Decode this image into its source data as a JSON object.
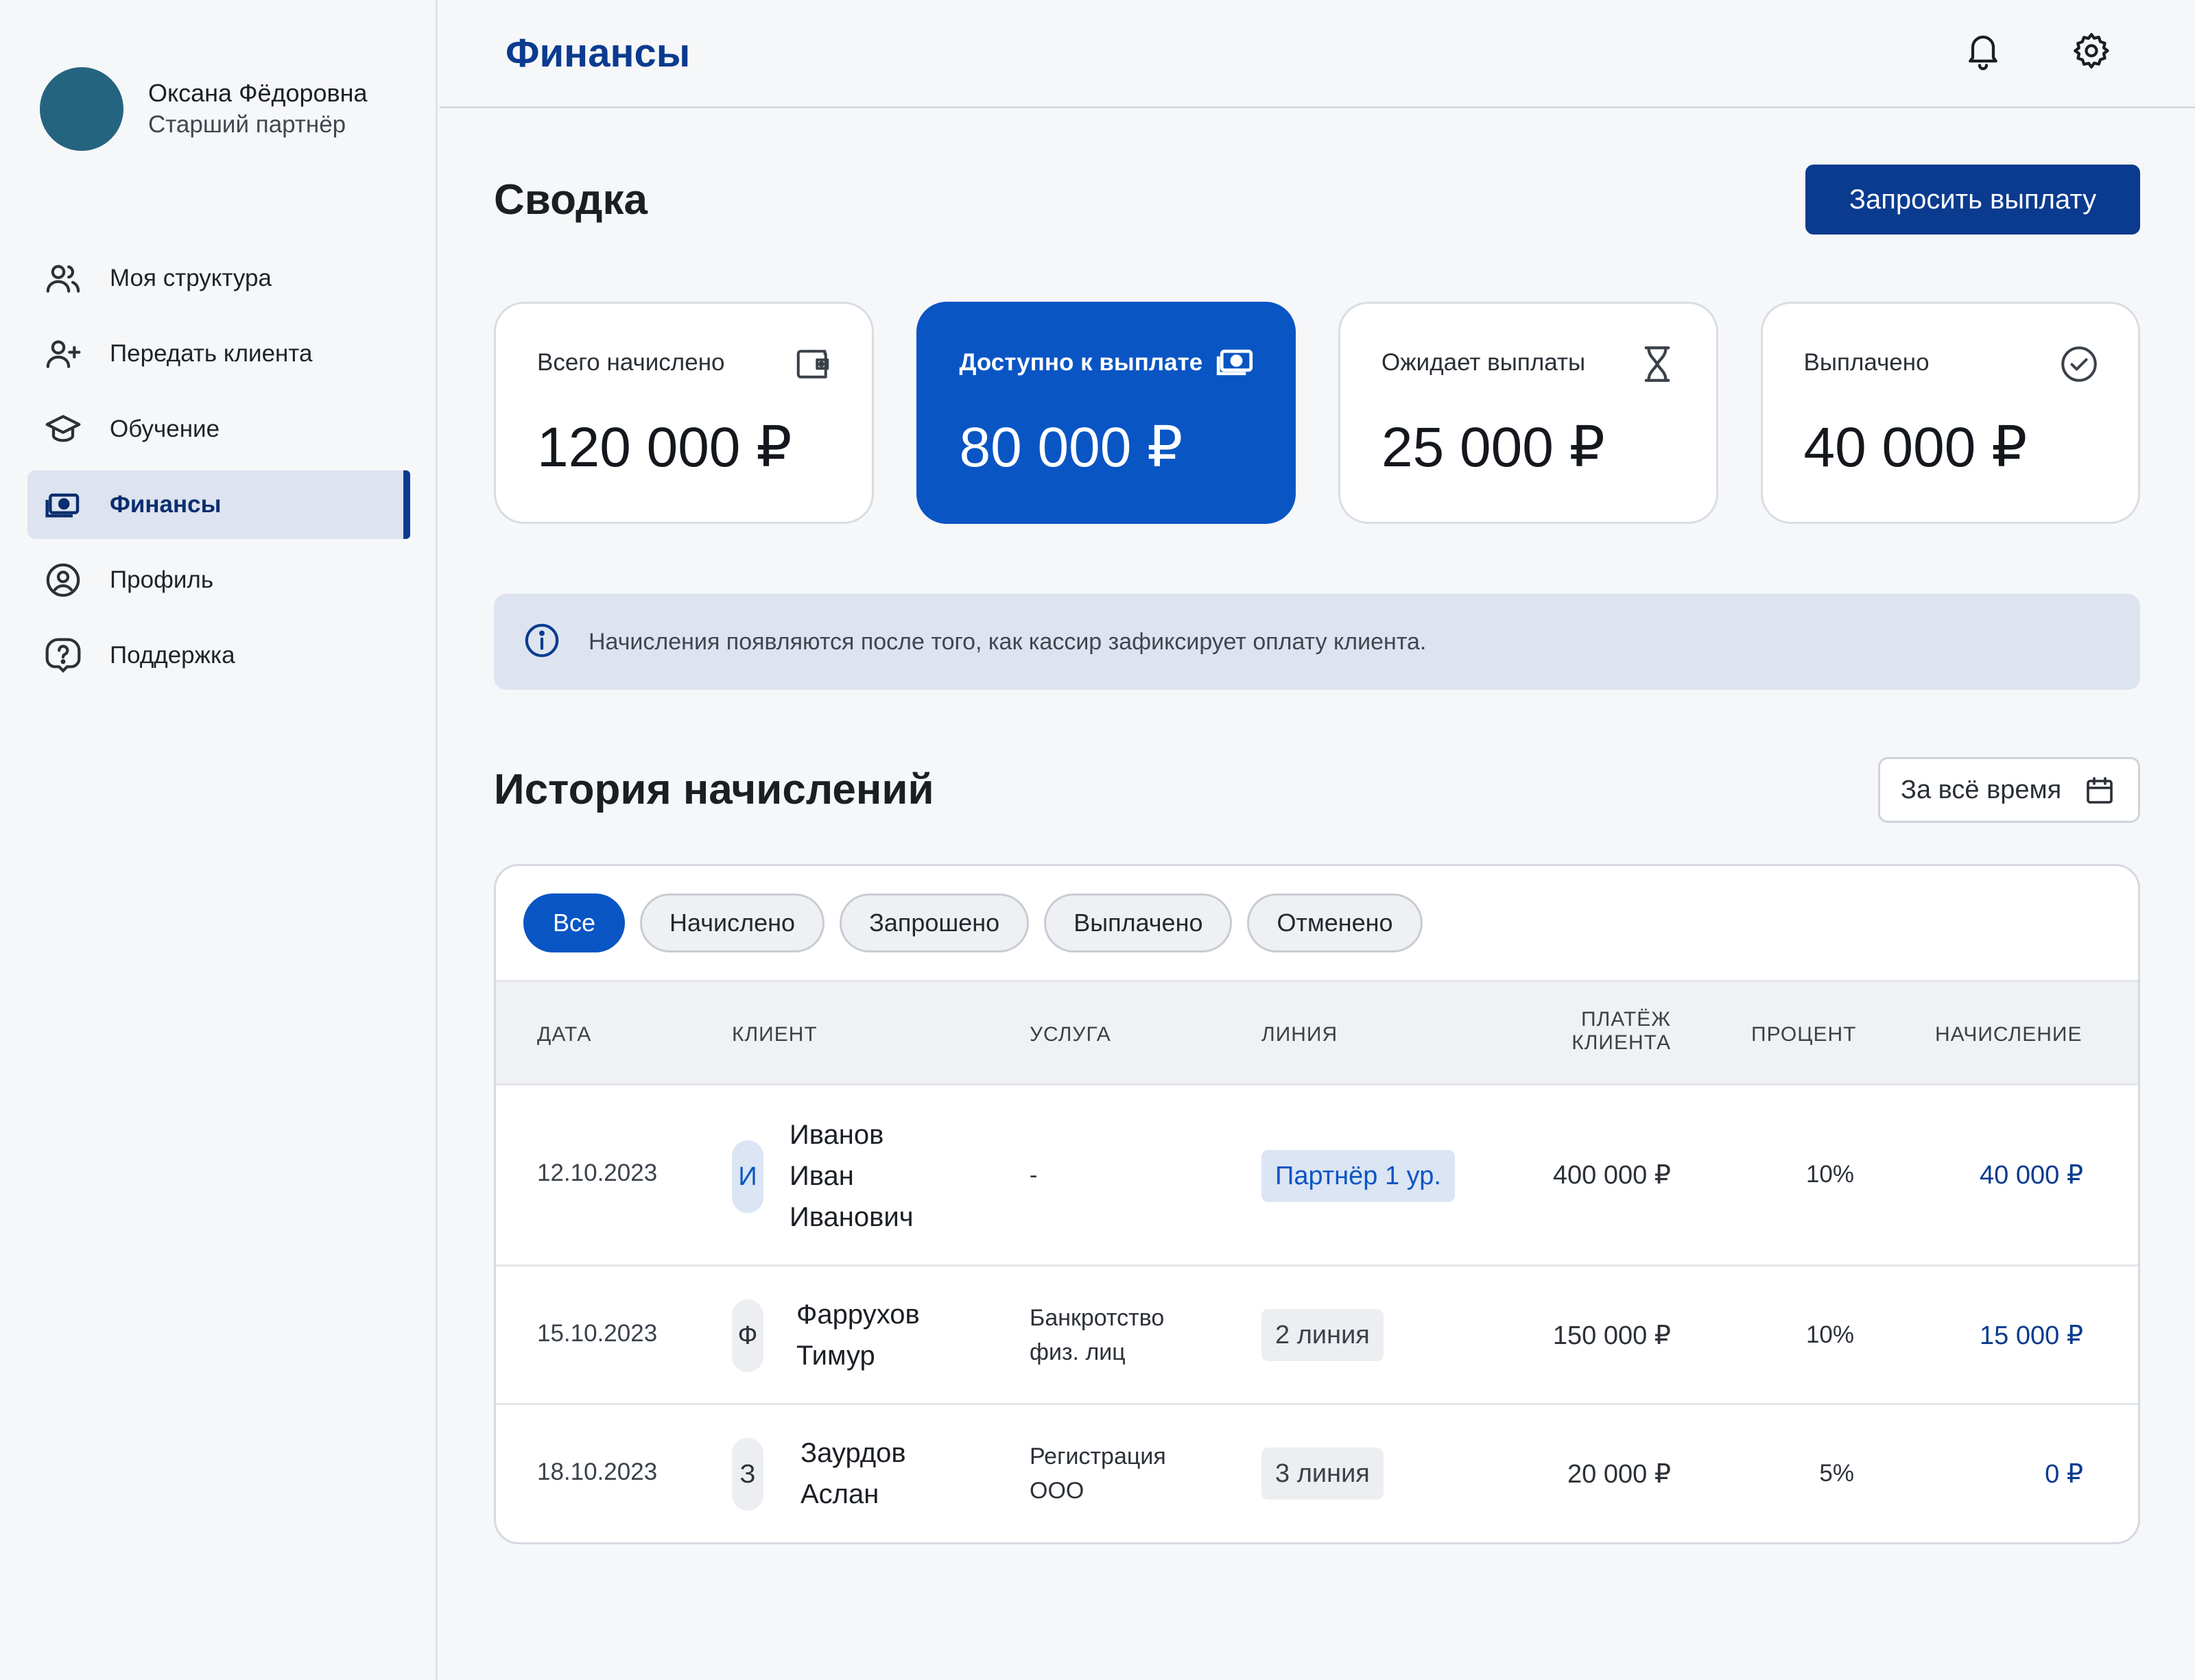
{
  "user": {
    "name": "Оксана Фёдоровна",
    "role": "Старший партнёр"
  },
  "nav": {
    "items": [
      {
        "label": "Моя структура",
        "icon": "users-icon"
      },
      {
        "label": "Передать клиента",
        "icon": "user-plus-icon"
      },
      {
        "label": "Обучение",
        "icon": "graduation-cap-icon"
      },
      {
        "label": "Финансы",
        "icon": "money-icon",
        "active": true
      },
      {
        "label": "Профиль",
        "icon": "user-circle-icon"
      },
      {
        "label": "Поддержка",
        "icon": "help-icon"
      }
    ]
  },
  "header": {
    "title": "Финансы"
  },
  "summary": {
    "title": "Сводка",
    "payout_button": "Запросить выплату",
    "cards": [
      {
        "label": "Всего начислено",
        "value": "120 000 ₽",
        "icon": "wallet-icon"
      },
      {
        "label": "Доступно к выплате",
        "value": "80 000 ₽",
        "icon": "money-icon"
      },
      {
        "label": "Ожидает выплаты",
        "value": "25 000 ₽",
        "icon": "hourglass-icon"
      },
      {
        "label": "Выплачено",
        "value": "40 000 ₽",
        "icon": "check-circle-icon"
      }
    ]
  },
  "info": {
    "text": "Начисления появляются после того, как кассир зафиксирует оплату клиента."
  },
  "history": {
    "title": "История начислений",
    "period": "За всё время",
    "filters": [
      "Все",
      "Начислено",
      "Запрошено",
      "Выплачено",
      "Отменено"
    ],
    "columns": [
      "ДАТА",
      "КЛИЕНТ",
      "УСЛУГА",
      "ЛИНИЯ",
      "ПЛАТЁЖ",
      "КЛИЕНТА",
      "ПРОЦЕНТ",
      "НАЧИСЛЕНИЕ"
    ],
    "rows": [
      {
        "date": "12.10.2023",
        "initial": "И",
        "name": [
          "Иванов",
          "Иван",
          "Иванович"
        ],
        "service": [
          "-"
        ],
        "line": "Партнёр 1 ур.",
        "payment": "400 000 ₽",
        "percent": "10%",
        "accrual": "40 000 ₽"
      },
      {
        "date": "15.10.2023",
        "initial": "Ф",
        "name": [
          "Фаррухов",
          "Тимур"
        ],
        "service": [
          "Банкротство",
          "физ. лиц"
        ],
        "line": "2 линия",
        "payment": "150 000 ₽",
        "percent": "10%",
        "accrual": "15 000 ₽"
      },
      {
        "date": "18.10.2023",
        "initial": "З",
        "name": [
          "Заурдов",
          "Аслан"
        ],
        "service": [
          "Регистрация",
          "ООО"
        ],
        "line": "3 линия",
        "payment": "20 000 ₽",
        "percent": "5%",
        "accrual": "0 ₽"
      }
    ]
  },
  "colors": {
    "primary": "#0a55c4",
    "navy": "#0a3b8f",
    "partner_tag_bg": "#dbe5f4",
    "line_tag_bg": "#eceef1"
  }
}
